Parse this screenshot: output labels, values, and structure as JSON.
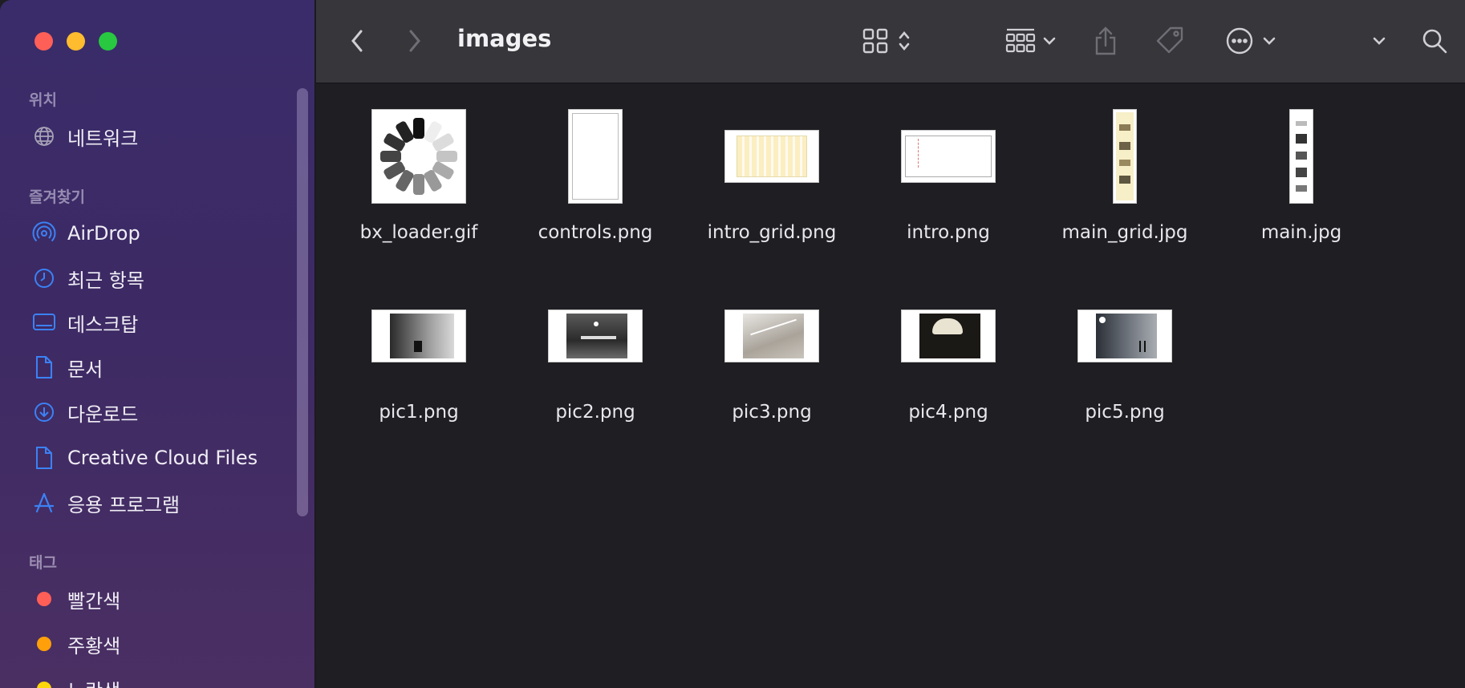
{
  "window": {
    "title": "images"
  },
  "colors": {
    "sidebar_accent": "#3b82f6",
    "tag_red": "#ff5f57",
    "tag_orange": "#ff9f0a",
    "tag_yellow": "#ffd60a"
  },
  "sidebar": {
    "locations_header": "위치",
    "locations": [
      {
        "label": "네트워크",
        "icon": "globe-icon"
      }
    ],
    "favorites_header": "즐겨찾기",
    "favorites": [
      {
        "label": "AirDrop",
        "icon": "airdrop-icon"
      },
      {
        "label": "최근 항목",
        "icon": "clock-icon"
      },
      {
        "label": "데스크탑",
        "icon": "desktop-icon"
      },
      {
        "label": "문서",
        "icon": "document-icon"
      },
      {
        "label": "다운로드",
        "icon": "download-icon"
      },
      {
        "label": "Creative Cloud Files",
        "icon": "file-icon"
      },
      {
        "label": "응용 프로그램",
        "icon": "applications-icon"
      }
    ],
    "tags_header": "태그",
    "tags": [
      {
        "label": "빨간색",
        "color": "#ff5f57"
      },
      {
        "label": "주황색",
        "color": "#ff9f0a"
      },
      {
        "label": "노란색",
        "color": "#ffd60a"
      }
    ]
  },
  "files": [
    {
      "name": "bx_loader.gif",
      "kind": "loader"
    },
    {
      "name": "controls.png",
      "kind": "portrait"
    },
    {
      "name": "intro_grid.png",
      "kind": "grid"
    },
    {
      "name": "intro.png",
      "kind": "intro"
    },
    {
      "name": "main_grid.jpg",
      "kind": "tall-yellow"
    },
    {
      "name": "main.jpg",
      "kind": "tall"
    },
    {
      "name": "pic1.png",
      "kind": "pic1"
    },
    {
      "name": "pic2.png",
      "kind": "pic2"
    },
    {
      "name": "pic3.png",
      "kind": "pic3"
    },
    {
      "name": "pic4.png",
      "kind": "pic4"
    },
    {
      "name": "pic5.png",
      "kind": "pic5"
    }
  ]
}
